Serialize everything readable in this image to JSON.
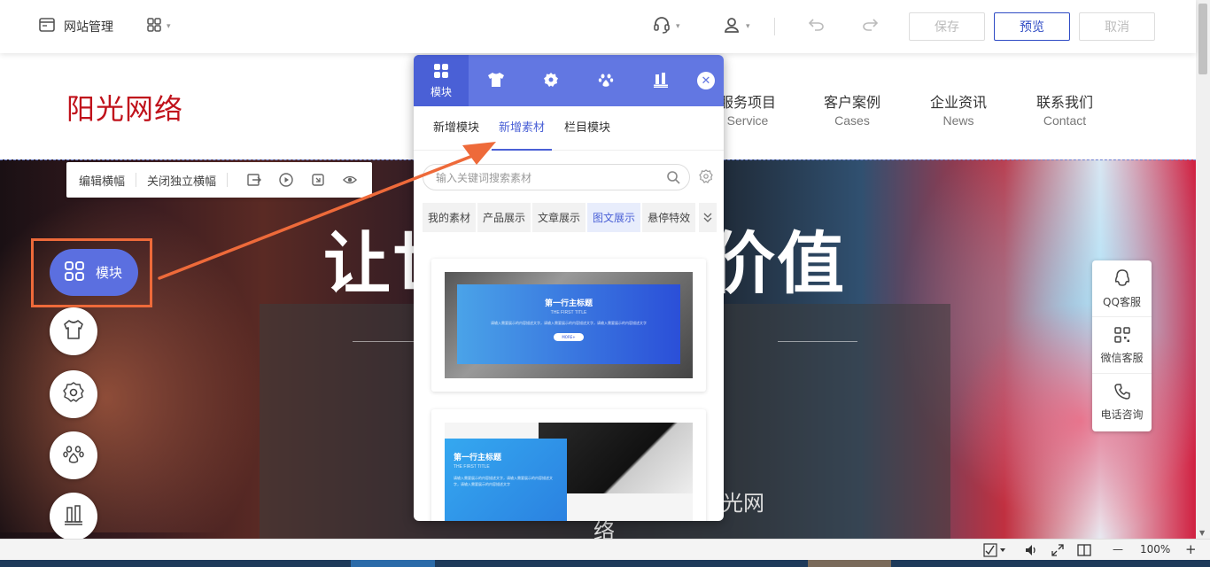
{
  "topbar": {
    "site_manage": "网站管理",
    "save": "保存",
    "preview": "预览",
    "cancel": "取消"
  },
  "site": {
    "logo": "阳光网络",
    "nav": [
      {
        "cn": "服务项目",
        "en": "Service"
      },
      {
        "cn": "客户案例",
        "en": "Cases"
      },
      {
        "cn": "企业资讯",
        "en": "News"
      },
      {
        "cn": "联系我们",
        "en": "Contact"
      }
    ]
  },
  "banner": {
    "title_left": "让世",
    "title_right": "的价值",
    "sub_left": "络",
    "sub_right": "光网"
  },
  "banner_tools": {
    "edit": "编辑横幅",
    "close_independent": "关闭独立横幅"
  },
  "side_menu": {
    "module": "模块"
  },
  "contact": {
    "qq": "QQ客服",
    "wechat": "微信客服",
    "phone": "电话咨询"
  },
  "panel": {
    "active_tab": "模块",
    "subtabs": [
      "新增模块",
      "新增素材",
      "栏目模块"
    ],
    "active_subtab": 1,
    "search_placeholder": "输入关键词搜索素材",
    "categories": [
      "我的素材",
      "产品展示",
      "文章展示",
      "图文展示",
      "悬停特效"
    ],
    "active_category": 3,
    "card1": {
      "title": "第一行主标题",
      "en": "THE FIRST TITLE",
      "body": "请输入需要展示的内容描述文字，请输入需要展示的内容描述文字，请输入需要展示的内容描述文字",
      "button": "MORE+"
    },
    "card2": {
      "title": "第一行主标题",
      "en": "THE FIRST TITLE",
      "body": "请输入需要展示的内容描述文字，请输入需要展示的内容描述文字，请输入需要展示的内容描述文字"
    }
  },
  "statusbar": {
    "zoom": "100%"
  },
  "colors": {
    "accent": "#5b6fe0",
    "panel_header": "#6277e2",
    "logo_red": "#c0121b",
    "annotation_orange": "#ee6a3a"
  }
}
